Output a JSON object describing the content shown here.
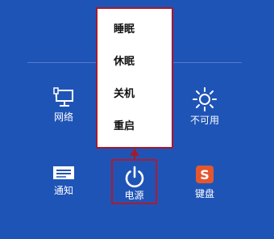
{
  "power_menu": {
    "items": [
      "睡眠",
      "休眠",
      "关机",
      "重启"
    ]
  },
  "settings": {
    "network": {
      "label": "网络",
      "icon": "network-icon"
    },
    "unavailable": {
      "label": "不可用",
      "icon": "brightness-icon"
    },
    "notifications": {
      "label": "通知",
      "icon": "notifications-icon"
    },
    "power": {
      "label": "电源",
      "icon": "power-icon"
    },
    "keyboard": {
      "label": "键盘",
      "icon": "keyboard-icon"
    }
  },
  "colors": {
    "background": "#1f54b7",
    "highlight": "#a51a2b",
    "keyboard_icon": "#e4572e"
  }
}
